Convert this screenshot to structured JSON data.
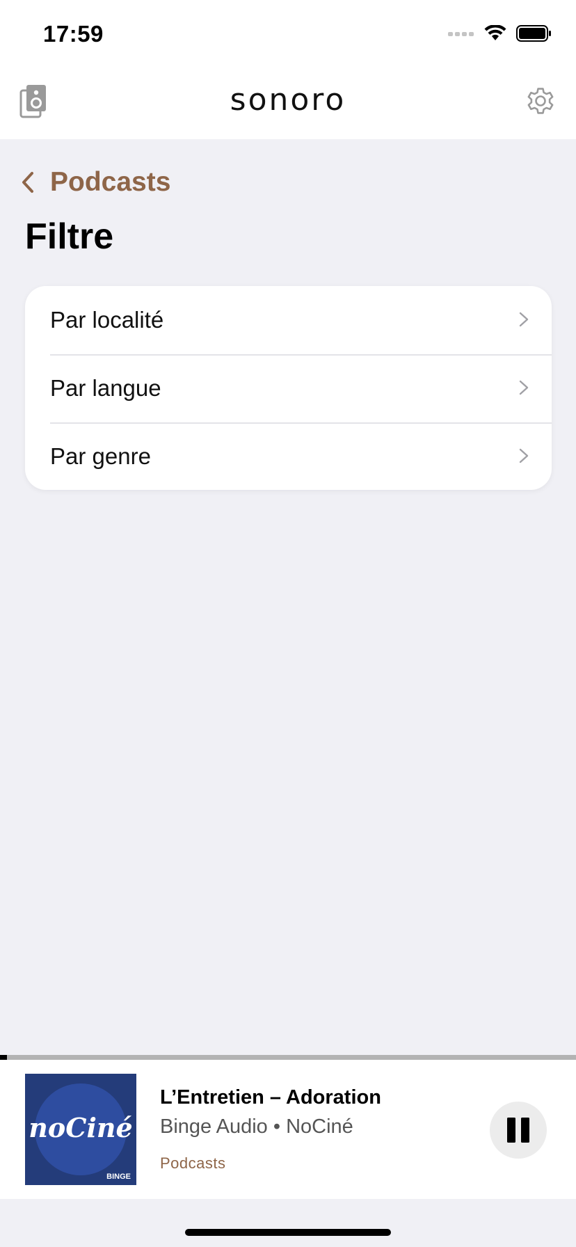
{
  "status_bar": {
    "time": "17:59"
  },
  "header": {
    "brand": "sonoro"
  },
  "nav": {
    "back_label": "Podcasts",
    "title": "Filtre"
  },
  "filters": [
    {
      "label": "Par localité"
    },
    {
      "label": "Par langue"
    },
    {
      "label": "Par genre"
    }
  ],
  "player": {
    "title": "L’Entretien – Adoration",
    "subtitle": "Binge Audio • NoCiné",
    "source": "Podcasts",
    "artwork_text": "noCiné",
    "artwork_badge": "BINGE",
    "progress": 0.012
  },
  "colors": {
    "accent": "#8e6548",
    "background": "#f0f0f5"
  }
}
